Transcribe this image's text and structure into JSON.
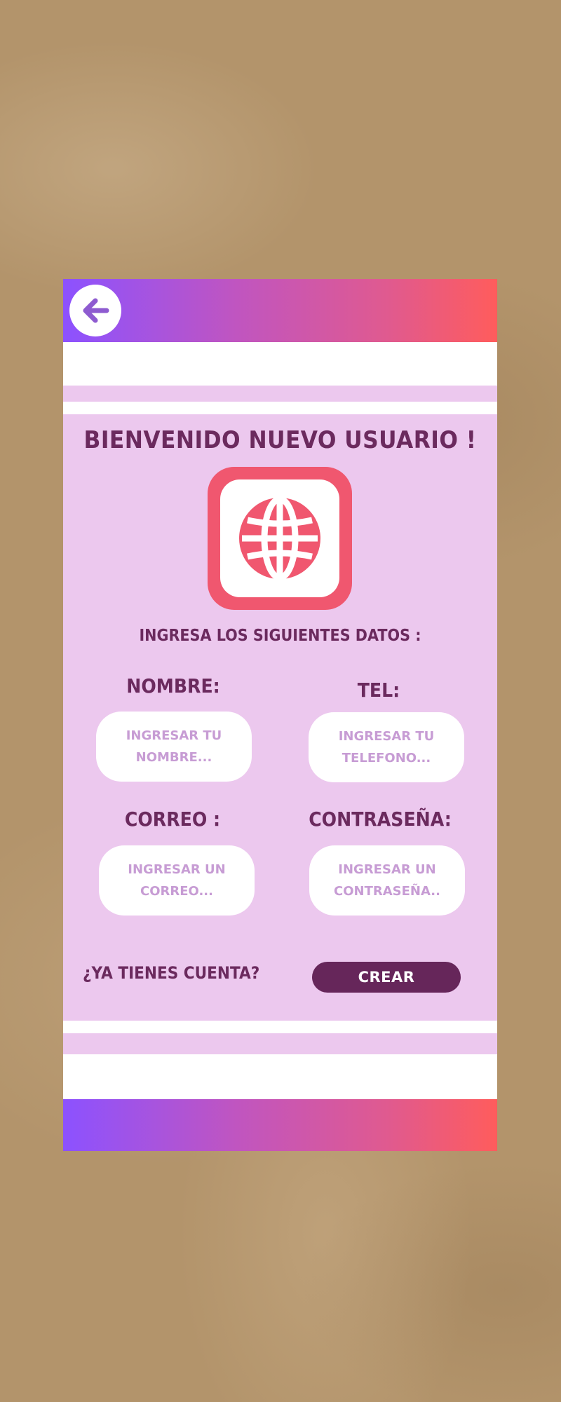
{
  "header": {
    "back_icon": "arrow-left-icon"
  },
  "main": {
    "title": "BIENVENIDO NUEVO USUARIO !",
    "app_icon": "globe-icon",
    "subtitle": "INGRESA LOS SIGUIENTES DATOS :"
  },
  "form": {
    "nombre": {
      "label": "NOMBRE:",
      "placeholder": "INGRESAR TU\nNOMBRE..."
    },
    "tel": {
      "label": "TEL:",
      "placeholder": "INGRESAR TU\nTELEFONO..."
    },
    "correo": {
      "label": "CORREO :",
      "placeholder": "INGRESAR UN\nCORREO..."
    },
    "contrasena": {
      "label": "CONTRASEÑA:",
      "placeholder": "INGRESAR UN\nCONTRASEÑA.."
    }
  },
  "footer": {
    "login_link": "¿YA TIENES CUENTA?",
    "create_button": "CREAR"
  },
  "colors": {
    "panel": "#ecc8ee",
    "text_dark": "#6b2a5e",
    "accent_red": "#f0576f",
    "button": "#66265a",
    "gradient_start": "#8c52ff",
    "gradient_end": "#ff5c5c",
    "placeholder": "#c79cd4"
  }
}
